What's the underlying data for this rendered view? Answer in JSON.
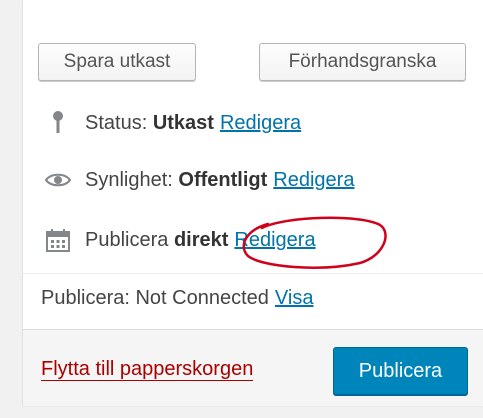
{
  "toolbar": {
    "save_draft_label": "Spara utkast",
    "preview_label": "Förhandsgranska"
  },
  "status": {
    "icon": "pin-icon",
    "label": "Status:",
    "value": "Utkast",
    "edit_link": "Redigera"
  },
  "visibility": {
    "icon": "eye-icon",
    "label": "Synlighet:",
    "value": "Offentligt",
    "edit_link": "Redigera"
  },
  "publish": {
    "icon": "calendar-icon",
    "label": "Publicera",
    "value": "direkt",
    "edit_link": "Redigera"
  },
  "connection": {
    "label": "Publicera: Not Connected",
    "view_link": "Visa"
  },
  "footer": {
    "trash_label": "Flytta till papperskorgen",
    "publish_button": "Publicera"
  },
  "colors": {
    "link": "#0073aa",
    "trash": "#a00000",
    "primary": "#0085ba",
    "annotation": "#d0021b"
  }
}
